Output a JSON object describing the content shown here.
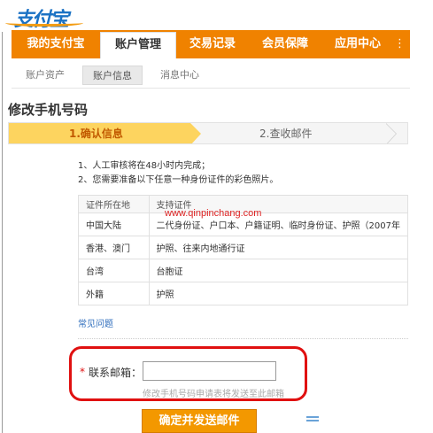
{
  "logo": {
    "text": "支付宝"
  },
  "main_nav": {
    "items": [
      {
        "label": "我的支付宝"
      },
      {
        "label": "账户管理"
      },
      {
        "label": "交易记录"
      },
      {
        "label": "会员保障"
      },
      {
        "label": "应用中心"
      }
    ],
    "more_label": "⋮"
  },
  "sub_nav": {
    "items": [
      {
        "label": "账户资产"
      },
      {
        "label": "账户信息"
      },
      {
        "label": "消息中心"
      }
    ]
  },
  "page_title": "修改手机号码",
  "steps": {
    "step1": "1.确认信息",
    "step2": "2.查收邮件"
  },
  "notes": [
    "1、人工审核将在48小时内完成；",
    "2、您需要准备以下任意一种身份证件的彩色照片。"
  ],
  "id_table": {
    "headers": [
      "证件所在地",
      "支持证件"
    ],
    "rows": [
      [
        "中国大陆",
        "二代身份证、户口本、户籍证明、临时身份证、护照（2007年"
      ],
      [
        "香港、澳门",
        "护照、往来内地通行证"
      ],
      [
        "台湾",
        "台胞证"
      ],
      [
        "外籍",
        "护照"
      ]
    ]
  },
  "watermark": "www.qinpinchang.com",
  "faq_label": "常见问题",
  "form": {
    "required_mark": "*",
    "email_label": "联系邮箱：",
    "email_value": "",
    "hint": "修改手机号码申请表将发送至此邮箱",
    "submit_label": "确定并发送邮件"
  },
  "colors": {
    "nav_orange": "#f08200",
    "step_active": "#fdd45f",
    "highlight_red": "#e01010",
    "button_orange": "#f39800",
    "link_blue": "#2f6ebd"
  }
}
